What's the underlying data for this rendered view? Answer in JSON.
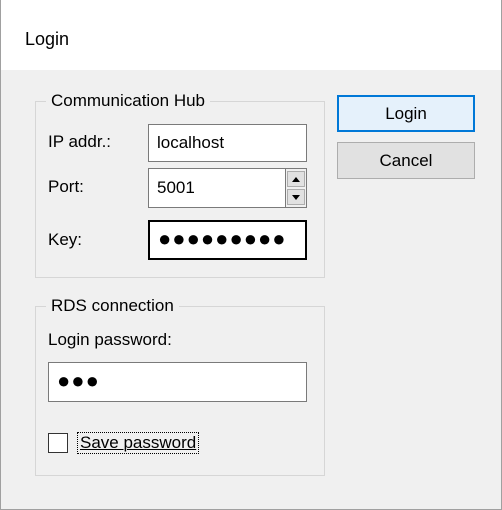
{
  "window": {
    "title": "Login"
  },
  "hub_group": {
    "legend": "Communication Hub",
    "ip_label": "IP addr.:",
    "ip_value": "localhost",
    "port_label": "Port:",
    "port_value": "5001",
    "key_label": "Key:",
    "key_value": "●●●●●●●●●"
  },
  "rds_group": {
    "legend": "RDS connection",
    "password_label": "Login password:",
    "password_value": "●●●",
    "save_password_label": "Save password",
    "save_password_checked": false
  },
  "buttons": {
    "login_label": "Login",
    "cancel_label": "Cancel"
  },
  "icons": {
    "spin_up": "chevron-up-icon",
    "spin_down": "chevron-down-icon"
  },
  "colors": {
    "window_bg": "#f0f0f0",
    "titlebar_bg": "#ffffff",
    "default_button_border": "#0078d7",
    "default_button_bg": "#e5f1fb",
    "group_border": "#d6d6d6"
  }
}
